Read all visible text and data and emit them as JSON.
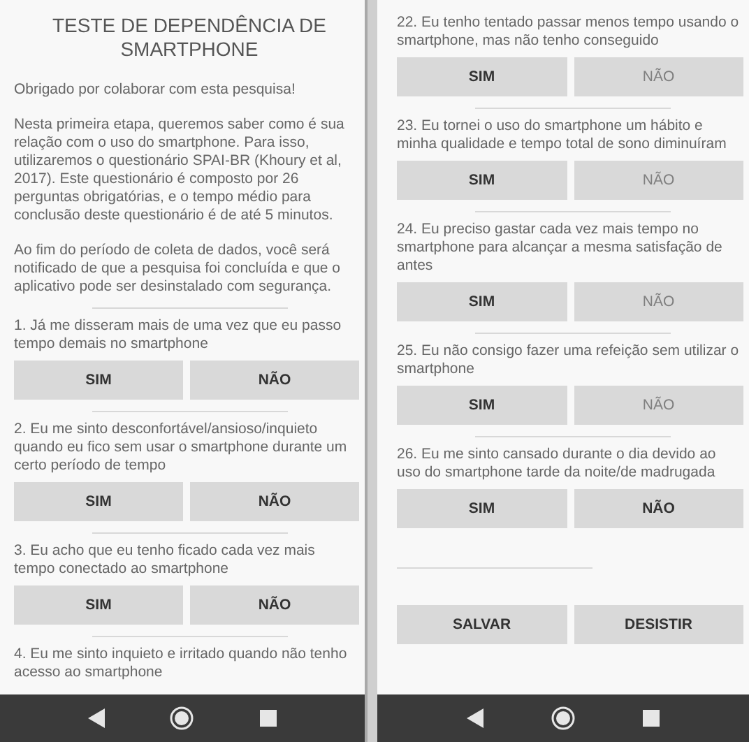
{
  "screens": [
    {
      "title": "TESTE DE DEPENDÊNCIA DE SMARTPHONE",
      "intro": [
        "Obrigado por colaborar com esta pesquisa!",
        "Nesta primeira etapa, queremos saber como é sua relação com o uso do smartphone. Para isso, utilizaremos o questionário SPAI-BR (Khoury et al, 2017). Este questionário é composto por 26 perguntas obrigatórias, e o tempo médio para conclusão deste questionário é de até 5 minutos.",
        "Ao fim do período de coleta de dados, você será notificado de que a pesquisa foi concluída e que o aplicativo pode ser desinstalado com segurança."
      ],
      "questions": [
        {
          "text": "1. Já me disseram mais de uma vez que eu passo tempo demais no smartphone",
          "answers": [
            {
              "label": "SIM",
              "disabled": false
            },
            {
              "label": "NÃO",
              "disabled": false
            }
          ]
        },
        {
          "text": "2. Eu me sinto desconfortável/ansioso/inquieto quando eu fico sem usar o smartphone durante um certo período de tempo",
          "answers": [
            {
              "label": "SIM",
              "disabled": false
            },
            {
              "label": "NÃO",
              "disabled": false
            }
          ]
        },
        {
          "text": "3. Eu acho que eu tenho ficado cada vez mais tempo conectado ao smartphone",
          "answers": [
            {
              "label": "SIM",
              "disabled": false
            },
            {
              "label": "NÃO",
              "disabled": false
            }
          ]
        },
        {
          "text": "4. Eu me sinto inquieto e irritado quando não tenho acesso ao smartphone"
        }
      ]
    },
    {
      "questions": [
        {
          "text": "22. Eu tenho tentado passar menos tempo usando o smartphone, mas não tenho conseguido",
          "answers": [
            {
              "label": "SIM",
              "disabled": false
            },
            {
              "label": "NÃO",
              "disabled": true
            }
          ]
        },
        {
          "text": "23. Eu tornei o uso do smartphone um hábito e minha qualidade e tempo total de sono diminuíram",
          "answers": [
            {
              "label": "SIM",
              "disabled": false
            },
            {
              "label": "NÃO",
              "disabled": true
            }
          ]
        },
        {
          "text": "24. Eu preciso gastar cada vez mais tempo no smartphone para alcançar a mesma satisfação de antes",
          "answers": [
            {
              "label": "SIM",
              "disabled": false
            },
            {
              "label": "NÃO",
              "disabled": true
            }
          ]
        },
        {
          "text": "25. Eu não consigo fazer uma refeição sem utilizar o smartphone",
          "answers": [
            {
              "label": "SIM",
              "disabled": false
            },
            {
              "label": "NÃO",
              "disabled": true
            }
          ]
        },
        {
          "text": "26. Eu me sinto cansado durante o dia devido ao uso do smartphone tarde da noite/de madrugada",
          "answers": [
            {
              "label": "SIM",
              "disabled": false
            },
            {
              "label": "NÃO",
              "disabled": false
            }
          ]
        }
      ],
      "actions": [
        "SALVAR",
        "DESISTIR"
      ]
    }
  ]
}
